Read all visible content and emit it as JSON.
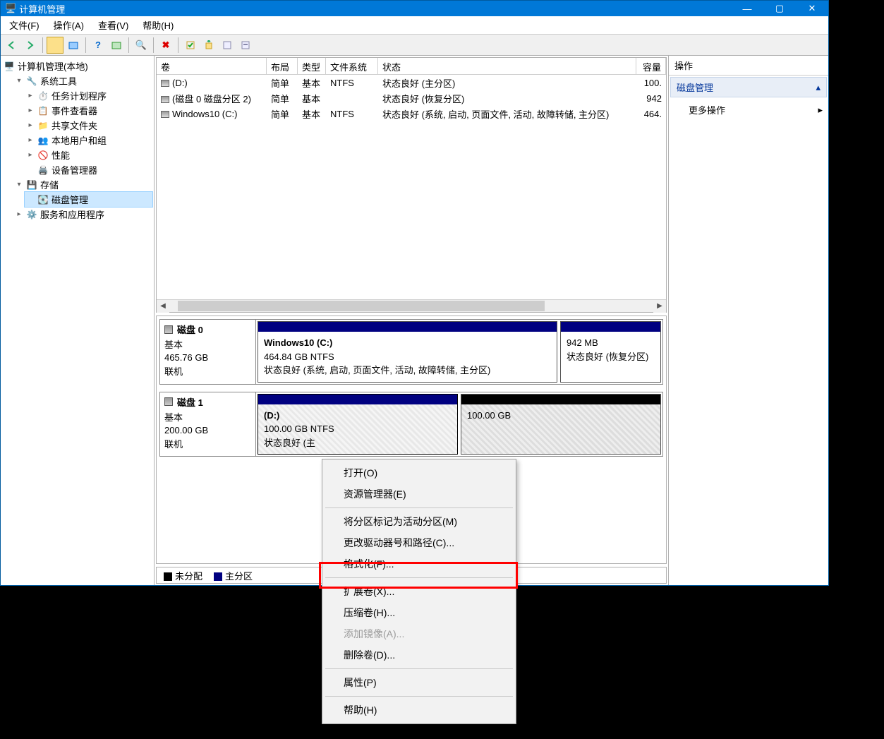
{
  "window": {
    "title": "计算机管理"
  },
  "menubar": [
    "文件(F)",
    "操作(A)",
    "查看(V)",
    "帮助(H)"
  ],
  "tree": {
    "root": "计算机管理(本地)",
    "systools": "系统工具",
    "systools_children": [
      "任务计划程序",
      "事件查看器",
      "共享文件夹",
      "本地用户和组",
      "性能",
      "设备管理器"
    ],
    "storage": "存储",
    "diskmgmt": "磁盘管理",
    "services": "服务和应用程序"
  },
  "volTable": {
    "headers": {
      "vol": "卷",
      "layout": "布局",
      "type": "类型",
      "fs": "文件系统",
      "status": "状态",
      "cap": "容量"
    },
    "rows": [
      {
        "vol": "(D:)",
        "layout": "简单",
        "type": "基本",
        "fs": "NTFS",
        "status": "状态良好 (主分区)",
        "cap": "100."
      },
      {
        "vol": "(磁盘 0 磁盘分区 2)",
        "layout": "简单",
        "type": "基本",
        "fs": "",
        "status": "状态良好 (恢复分区)",
        "cap": "942"
      },
      {
        "vol": "Windows10 (C:)",
        "layout": "简单",
        "type": "基本",
        "fs": "NTFS",
        "status": "状态良好 (系统, 启动, 页面文件, 活动, 故障转储, 主分区)",
        "cap": "464."
      }
    ]
  },
  "disks": [
    {
      "name": "磁盘 0",
      "type": "基本",
      "size": "465.76 GB",
      "state": "联机",
      "parts": [
        {
          "title": "Windows10  (C:)",
          "line1": "464.84 GB NTFS",
          "line2": "状态良好 (系统, 启动, 页面文件, 活动, 故障转储, 主分区)",
          "bar": "navy",
          "flex": 3
        },
        {
          "title": "",
          "line1": "942 MB",
          "line2": "状态良好 (恢复分区)",
          "bar": "navy",
          "flex": 1
        }
      ]
    },
    {
      "name": "磁盘 1",
      "type": "基本",
      "size": "200.00 GB",
      "state": "联机",
      "parts": [
        {
          "title": "(D:)",
          "line1": "100.00 GB NTFS",
          "line2": "状态良好 (主",
          "bar": "navy",
          "flex": 1,
          "sel": true
        },
        {
          "title": "",
          "line1": "100.00 GB",
          "line2": "",
          "bar": "black",
          "flex": 1,
          "hatched": true
        }
      ]
    }
  ],
  "legend": {
    "unalloc": "未分配",
    "primary": "主分区"
  },
  "actions": {
    "header": "操作",
    "section": "磁盘管理",
    "more": "更多操作"
  },
  "ctx": {
    "items": [
      {
        "t": "打开(O)"
      },
      {
        "t": "资源管理器(E)"
      },
      {
        "sep": true
      },
      {
        "t": "将分区标记为活动分区(M)"
      },
      {
        "t": "更改驱动器号和路径(C)..."
      },
      {
        "t": "格式化(F)..."
      },
      {
        "sep": true
      },
      {
        "t": "扩展卷(X)...",
        "hl": true
      },
      {
        "t": "压缩卷(H)..."
      },
      {
        "t": "添加镜像(A)...",
        "disabled": true
      },
      {
        "t": "删除卷(D)..."
      },
      {
        "sep": true
      },
      {
        "t": "属性(P)"
      },
      {
        "sep": true
      },
      {
        "t": "帮助(H)"
      }
    ]
  }
}
